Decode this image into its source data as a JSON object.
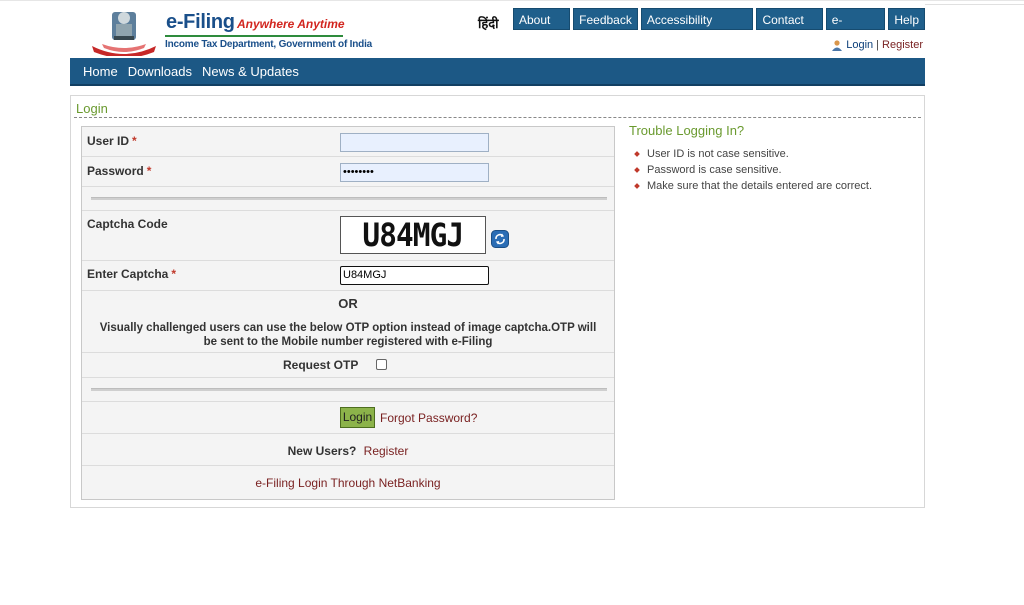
{
  "header": {
    "brand_title": "e-Filing",
    "brand_tagline": "Anywhere Anytime",
    "brand_subtitle": "Income Tax Department, Government of India",
    "hindi_link": "हिंदी",
    "top_nav": [
      "About Us",
      "Feedback",
      "Accessibility Options",
      "Contact Us",
      "e-Nivaran",
      "Help"
    ],
    "login_link": "Login",
    "separator": "|",
    "register_link": "Register"
  },
  "main_nav": [
    "Home",
    "Downloads",
    "News & Updates"
  ],
  "login_form": {
    "section_title": "Login",
    "user_id_label": "User ID",
    "password_label": "Password",
    "required_mark": "*",
    "user_id_value": "",
    "password_value": "••••••••",
    "captcha_code_label": "Captcha Code",
    "captcha_image_text": "U84MGJ",
    "enter_captcha_label": "Enter Captcha",
    "enter_captcha_value": "U84MGJ",
    "or_text": "OR",
    "otp_message": "Visually challenged users can use the below OTP option instead of image captcha.OTP will be sent to the Mobile number registered with e-Filing",
    "request_otp_label": "Request OTP",
    "login_button": "Login",
    "forgot_password": "Forgot Password?",
    "new_users_label": "New Users?",
    "register_link": "Register",
    "netbanking_link": "e-Filing Login Through NetBanking"
  },
  "trouble": {
    "title": "Trouble Logging In?",
    "tips": [
      "User ID is not case sensitive.",
      "Password is case sensitive.",
      "Make sure that the details entered are correct."
    ]
  },
  "colors": {
    "nav_blue": "#1c5885",
    "button_blue": "#1f5f8b",
    "accent_green": "#6a9a2f",
    "link_maroon": "#7a2222",
    "login_green": "#8cb34a"
  }
}
